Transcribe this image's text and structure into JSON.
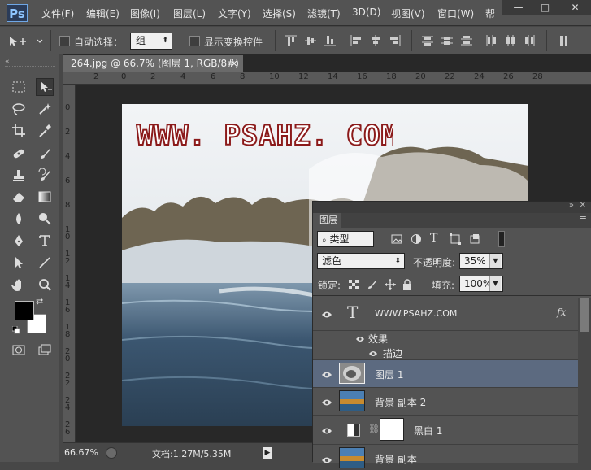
{
  "app": {
    "logo": "Ps"
  },
  "menu": [
    "文件(F)",
    "编辑(E)",
    "图像(I)",
    "图层(L)",
    "文字(Y)",
    "选择(S)",
    "滤镜(T)",
    "3D(D)",
    "视图(V)",
    "窗口(W)",
    "帮"
  ],
  "window_controls": {
    "minimize": "—",
    "maximize": "□",
    "close": "✕"
  },
  "options": {
    "auto_select_label": "自动选择：",
    "auto_select_value": "组",
    "show_transform_label": "显示变换控件"
  },
  "document": {
    "tab_title": "264.jpg @ 66.7% (图层 1, RGB/8#) *",
    "tab_close": "×",
    "ruler_h": [
      "2",
      "0",
      "2",
      "4",
      "6",
      "8",
      "10",
      "12",
      "14",
      "16",
      "18",
      "20",
      "22",
      "24",
      "26",
      "28"
    ],
    "ruler_v": [
      "0",
      "2",
      "4",
      "6",
      "8",
      "1\n0",
      "1\n2",
      "1\n4",
      "1\n6",
      "1\n8",
      "2\n0",
      "2\n2",
      "2\n4",
      "2\n6"
    ],
    "image_text": "WWW. PSAHZ. COM"
  },
  "status": {
    "zoom": "66.67%",
    "doc_info": "文档:1.27M/5.35M"
  },
  "layers_panel": {
    "tab": "图层",
    "filter_kind": "类型",
    "blend_mode": "滤色",
    "opacity_label": "不透明度:",
    "opacity_value": "35%",
    "lock_label": "锁定:",
    "fill_label": "填充:",
    "fill_value": "100%",
    "layers": [
      {
        "name": "WWW.PSAHZ.COM",
        "type": "text",
        "fx": "fx"
      },
      {
        "name": "效果",
        "type": "effects"
      },
      {
        "name": "描边",
        "type": "effect"
      },
      {
        "name": "图层 1",
        "type": "pixel",
        "selected": true
      },
      {
        "name": "背景 副本 2",
        "type": "pixel"
      },
      {
        "name": "黑白 1",
        "type": "adjustment"
      },
      {
        "name": "背景 副本",
        "type": "pixel"
      }
    ]
  },
  "colors": {
    "foreground": "#000000",
    "background": "#ffffff",
    "selected_layer": "#5c6a80",
    "text_stroke": "#8b1a1a"
  }
}
